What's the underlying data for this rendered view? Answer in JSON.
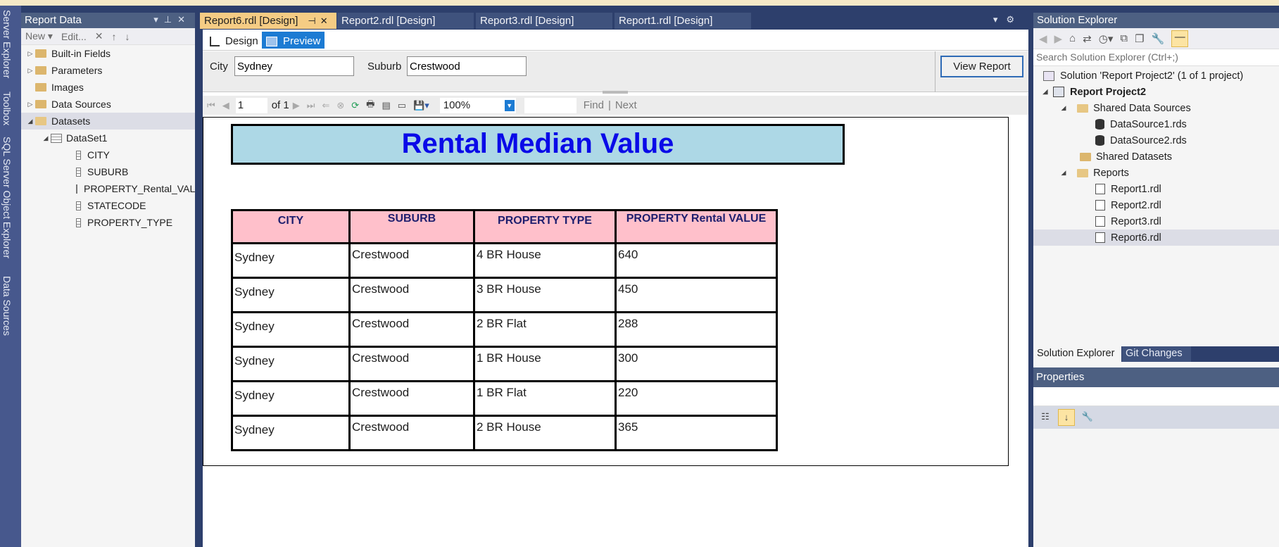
{
  "side_tabs": [
    "Server Explorer",
    "Toolbox",
    "SQL Server Object Explorer",
    "Data Sources"
  ],
  "report_data": {
    "title": "Report Data",
    "toolbar": {
      "new": "New ▾",
      "edit": "Edit..."
    },
    "tree": {
      "builtin": "Built-in Fields",
      "parameters": "Parameters",
      "images": "Images",
      "data_sources": "Data Sources",
      "datasets": "Datasets",
      "dataset1": "DataSet1",
      "fields": [
        "CITY",
        "SUBURB",
        "PROPERTY_Rental_VALUE",
        "STATECODE",
        "PROPERTY_TYPE"
      ]
    }
  },
  "doc_tabs": [
    "Report6.rdl [Design]",
    "Report2.rdl [Design]",
    "Report3.rdl [Design]",
    "Report1.rdl [Design]"
  ],
  "modes": {
    "design": "Design",
    "preview": "Preview"
  },
  "params": {
    "city_label": "City",
    "city_value": "Sydney",
    "suburb_label": "Suburb",
    "suburb_value": "Crestwood",
    "view_report": "View Report"
  },
  "report_toolbar": {
    "page": "1",
    "of_label": "of",
    "total_pages": "1",
    "zoom": "100%",
    "find": "Find",
    "next": "Next"
  },
  "report": {
    "title": "Rental Median Value",
    "headers": [
      "CITY",
      "SUBURB",
      "PROPERTY TYPE",
      "PROPERTY Rental VALUE"
    ],
    "rows": [
      [
        "Sydney",
        "Crestwood",
        "4 BR House",
        "640"
      ],
      [
        "Sydney",
        "Crestwood",
        "3 BR House",
        "450"
      ],
      [
        "Sydney",
        "Crestwood",
        "2 BR Flat",
        "288"
      ],
      [
        "Sydney",
        "Crestwood",
        "1 BR House",
        "300"
      ],
      [
        "Sydney",
        "Crestwood",
        "1 BR Flat",
        "220"
      ],
      [
        "Sydney",
        "Crestwood",
        "2 BR House",
        "365"
      ]
    ]
  },
  "solution_explorer": {
    "title": "Solution Explorer",
    "search_placeholder": "Search Solution Explorer (Ctrl+;)",
    "solution": "Solution 'Report Project2' (1 of 1 project)",
    "project": "Report Project2",
    "shared_data_sources": "Shared Data Sources",
    "ds_files": [
      "DataSource1.rds",
      "DataSource2.rds"
    ],
    "shared_datasets": "Shared Datasets",
    "reports_folder": "Reports",
    "report_files": [
      "Report1.rdl",
      "Report2.rdl",
      "Report3.rdl",
      "Report6.rdl"
    ],
    "tab_se": "Solution Explorer",
    "tab_git": "Git Changes"
  },
  "properties": {
    "title": "Properties"
  },
  "colors": {
    "accent": "#1c7bd3",
    "title_fill": "#add8e6",
    "header_fill": "#ffc0cb",
    "title_text": "#0a0ae8",
    "active_tab": "#f5cc84"
  }
}
